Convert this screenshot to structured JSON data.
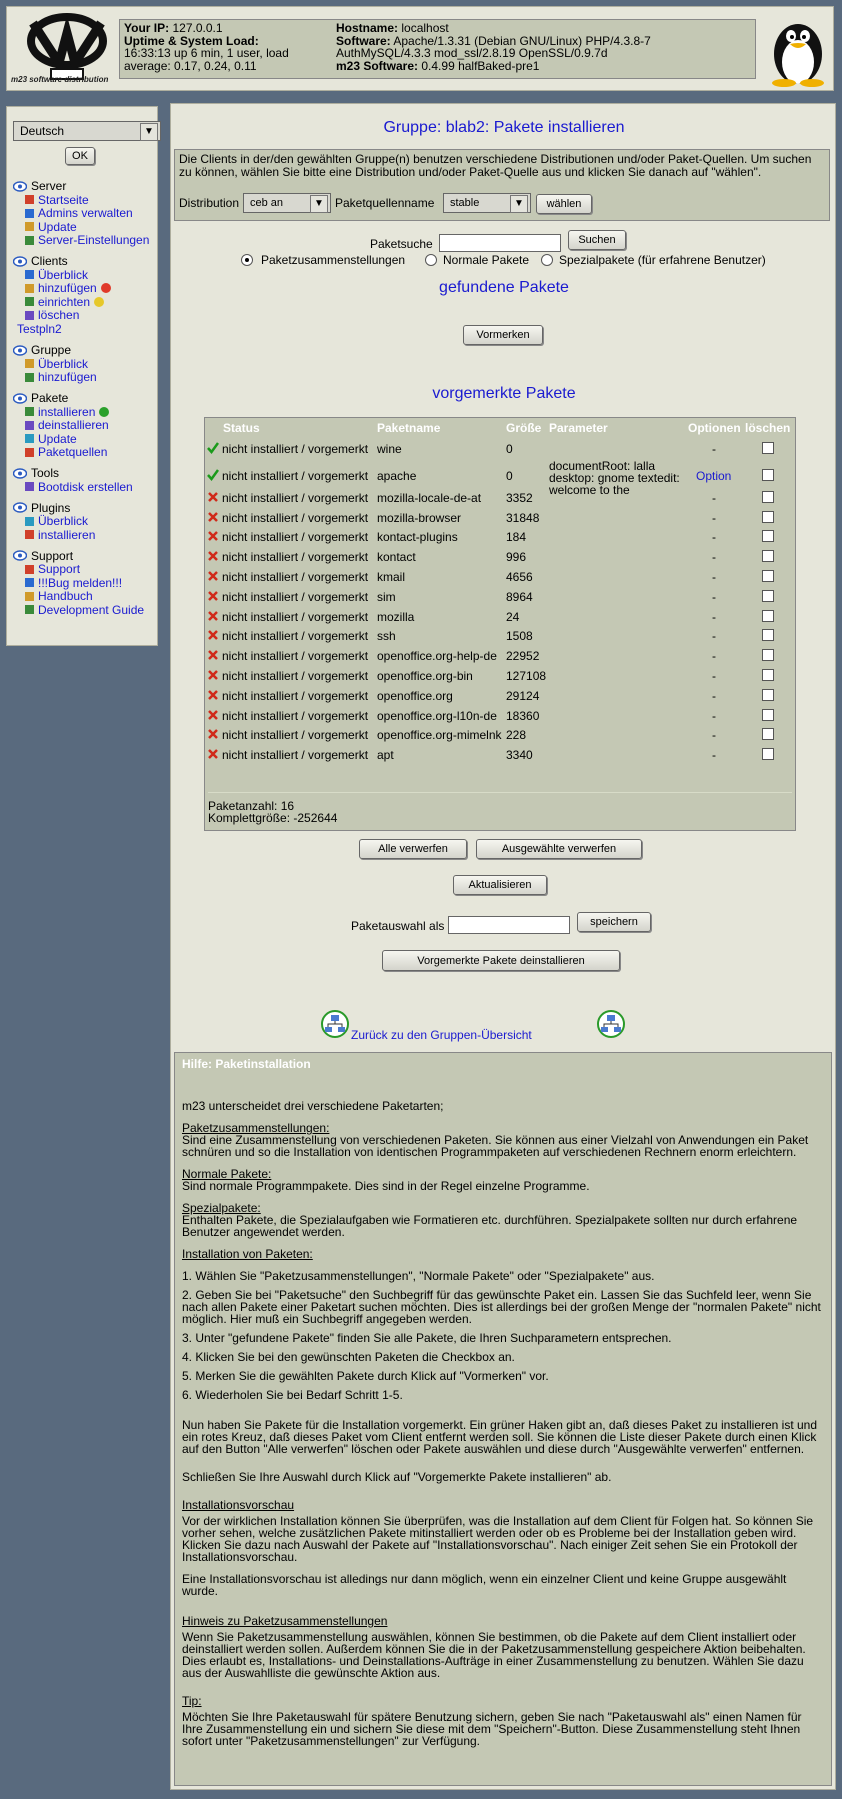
{
  "header": {
    "logo_text": "m23 software distribution",
    "your_ip_label": "Your IP:",
    "your_ip": "127.0.0.1",
    "uptime_label": "Uptime & System Load:",
    "uptime_value": "16:33:13 up 6 min, 1 user, load average: 0.17, 0.24, 0.11",
    "hostname_label": "Hostname:",
    "hostname": "localhost",
    "software_label": "Software:",
    "software_value": "Apache/1.3.31 (Debian GNU/Linux) PHP/4.3.8-7 AuthMySQL/4.3.3 mod_ssl/2.8.19 OpenSSL/0.9.7d",
    "m23_label": "m23 Software:",
    "m23_version": "0.4.99 halfBaked-pre1"
  },
  "sidebar": {
    "language": "Deutsch",
    "ok_label": "OK",
    "sections": [
      {
        "title": "Server",
        "items": [
          "Startseite",
          "Admins verwalten",
          "Update",
          "Server-Einstellungen"
        ]
      },
      {
        "title": "Clients",
        "items": [
          "Überblick",
          "hinzufügen",
          "einrichten",
          "löschen"
        ],
        "extra": "Testpln2"
      },
      {
        "title": "Gruppe",
        "items": [
          "Überblick",
          "hinzufügen"
        ]
      },
      {
        "title": "Pakete",
        "items": [
          "installieren",
          "deinstallieren",
          "Update",
          "Paketquellen"
        ]
      },
      {
        "title": "Tools",
        "items": [
          "Bootdisk erstellen"
        ]
      },
      {
        "title": "Plugins",
        "items": [
          "Überblick",
          "installieren"
        ]
      },
      {
        "title": "Support",
        "items": [
          "Support",
          "!!!Bug melden!!!",
          "Handbuch",
          "Development Guide"
        ]
      }
    ]
  },
  "main": {
    "title": "Gruppe: blab2: Pakete installieren",
    "notice": "Die Clients in der/den gewählten Gruppe(n) benutzen verschiedene Distributionen und/oder Paket-Quellen. Um suchen zu können, wählen Sie bitte eine Distribution und/oder Paket-Quelle aus und klicken Sie danach auf \"wählen\".",
    "distribution_label": "Distribution",
    "distribution_value": "ceb an",
    "source_label": "Paketquellenname",
    "source_value": "stable",
    "choose_label": "wählen",
    "search_label": "Paketsuche",
    "search_button": "Suchen",
    "radio_options": [
      "Paketzusammenstellungen",
      "Normale Pakete",
      "Spezialpakete (für erfahrene Benutzer)"
    ],
    "found_title": "gefundene Pakete",
    "mark_button": "Vormerken",
    "marked_title": "vorgemerkte Pakete",
    "table_headers": [
      "Status",
      "Paketname",
      "Größe",
      "Parameter",
      "Optionen",
      "löschen"
    ],
    "packages": [
      {
        "ok": true,
        "status": "nicht installiert / vorgemerkt",
        "name": "wine",
        "size": "0",
        "param": "",
        "option": "-"
      },
      {
        "ok": true,
        "status": "nicht installiert / vorgemerkt",
        "name": "apache",
        "size": "0",
        "param": "documentRoot: lalla desktop: gnome textedit: welcome to the",
        "option": "Option"
      },
      {
        "ok": false,
        "status": "nicht installiert / vorgemerkt",
        "name": "mozilla-locale-de-at",
        "size": "3352",
        "param": "",
        "option": "-"
      },
      {
        "ok": false,
        "status": "nicht installiert / vorgemerkt",
        "name": "mozilla-browser",
        "size": "31848",
        "param": "",
        "option": "-"
      },
      {
        "ok": false,
        "status": "nicht installiert / vorgemerkt",
        "name": "kontact-plugins",
        "size": "184",
        "param": "",
        "option": "-"
      },
      {
        "ok": false,
        "status": "nicht installiert / vorgemerkt",
        "name": "kontact",
        "size": "996",
        "param": "",
        "option": "-"
      },
      {
        "ok": false,
        "status": "nicht installiert / vorgemerkt",
        "name": "kmail",
        "size": "4656",
        "param": "",
        "option": "-"
      },
      {
        "ok": false,
        "status": "nicht installiert / vorgemerkt",
        "name": "sim",
        "size": "8964",
        "param": "",
        "option": "-"
      },
      {
        "ok": false,
        "status": "nicht installiert / vorgemerkt",
        "name": "mozilla",
        "size": "24",
        "param": "",
        "option": "-"
      },
      {
        "ok": false,
        "status": "nicht installiert / vorgemerkt",
        "name": "ssh",
        "size": "1508",
        "param": "",
        "option": "-"
      },
      {
        "ok": false,
        "status": "nicht installiert / vorgemerkt",
        "name": "openoffice.org-help-de",
        "size": "22952",
        "param": "",
        "option": "-"
      },
      {
        "ok": false,
        "status": "nicht installiert / vorgemerkt",
        "name": "openoffice.org-bin",
        "size": "127108",
        "param": "",
        "option": "-"
      },
      {
        "ok": false,
        "status": "nicht installiert / vorgemerkt",
        "name": "openoffice.org",
        "size": "29124",
        "param": "",
        "option": "-"
      },
      {
        "ok": false,
        "status": "nicht installiert / vorgemerkt",
        "name": "openoffice.org-l10n-de",
        "size": "18360",
        "param": "",
        "option": "-"
      },
      {
        "ok": false,
        "status": "nicht installiert / vorgemerkt",
        "name": "openoffice.org-mimelnk",
        "size": "228",
        "param": "",
        "option": "-"
      },
      {
        "ok": false,
        "status": "nicht installiert / vorgemerkt",
        "name": "apt",
        "size": "3340",
        "param": "",
        "option": "-"
      }
    ],
    "package_count": "Paketanzahl: 16",
    "total_size": "Komplettgröße: -252644",
    "discard_all": "Alle verwerfen",
    "discard_selected": "Ausgewählte verwerfen",
    "refresh": "Aktualisieren",
    "save_as_label": "Paketauswahl als",
    "save_button": "speichern",
    "uninstall_marked": "Vorgemerkte Pakete deinstallieren",
    "back_link": "Zurück zu den Gruppen-Übersicht"
  },
  "help": {
    "title": "Hilfe: Paketinstallation",
    "intro": "m23 unterscheidet drei verschiedene Paketarten;",
    "t1": "Paketzusammenstellungen:",
    "p1": "Sind eine Zusammenstellung von verschiedenen Paketen. Sie können aus einer Vielzahl von Anwendungen ein Paket schnüren und so die Installation von identischen Programmpaketen auf verschiedenen Rechnern enorm erleichtern.",
    "t2": "Normale Pakete:",
    "p2": "Sind normale Programmpakete. Dies sind in der Regel einzelne Programme.",
    "t3": "Spezialpakete:",
    "p3": "Enthalten Pakete, die Spezialaufgaben wie Formatieren etc. durchführen. Spezialpakete sollten nur durch erfahrene Benutzer angewendet werden.",
    "t4": "Installation von Paketen:",
    "steps": [
      "1. Wählen Sie \"Paketzusammenstellungen\", \"Normale Pakete\" oder \"Spezialpakete\" aus.",
      "2. Geben Sie bei \"Paketsuche\" den Suchbegriff für das gewünschte Paket ein. Lassen Sie das Suchfeld leer, wenn Sie nach allen Pakete einer Paketart suchen möchten. Dies ist allerdings bei der großen Menge der \"normalen Pakete\" nicht möglich. Hier muß ein Suchbegriff angegeben werden.",
      "3. Unter \"gefundene Pakete\" finden Sie alle Pakete, die Ihren Suchparametern entsprechen.",
      "4. Klicken Sie bei den gewünschten Paketen die Checkbox an.",
      "5. Merken Sie die gewählten Pakete durch Klick auf \"Vormerken\" vor.",
      "6. Wiederholen Sie bei Bedarf Schritt 1-5."
    ],
    "p4": "Nun haben Sie Pakete für die Installation vorgemerkt. Ein grüner Haken gibt an, daß dieses Paket zu installieren ist und ein rotes Kreuz, daß dieses Paket vom Client entfernt werden soll. Sie können die Liste dieser Pakete durch einen Klick auf den Button \"Alle verwerfen\" löschen oder Pakete auswählen und diese durch \"Ausgewählte verwerfen\" entfernen.",
    "p5": "Schließen Sie Ihre Auswahl durch Klick auf \"Vorgemerkte Pakete installieren\" ab.",
    "t5": "Installationsvorschau",
    "p6": "Vor der wirklichen Installation können Sie überprüfen, was die Installation auf dem Client für Folgen hat. So können Sie vorher sehen, welche zusätzlichen Pakete mitinstalliert werden oder ob es Probleme bei der Installation geben wird. Klicken Sie dazu nach Auswahl der Pakete auf \"Installationsvorschau\". Nach einiger Zeit sehen Sie ein Protokoll der Installationsvorschau.",
    "p7": "Eine Installationsvorschau ist alledings nur dann möglich, wenn ein einzelner Client und keine Gruppe ausgewählt wurde.",
    "t6": "Hinweis zu Paketzusammenstellungen",
    "p8": "Wenn Sie Paketzusammenstellung auswählen, können Sie bestimmen, ob die Pakete auf dem Client installiert oder deinstalliert werden sollen. Außerdem können Sie die in der Paketzusammenstellung gespeichere Aktion beibehalten. Dies erlaubt es, Installations- und Deinstallations-Aufträge in einer Zusammenstellung zu benutzen. Wählen Sie dazu aus der Auswahlliste die gewünschte Aktion aus.",
    "t7": "Tip:",
    "p9": "Möchten Sie Ihre Paketauswahl für spätere Benutzung sichern, geben Sie nach \"Paketauswahl als\" einen Namen für Ihre Zusammenstellung ein und sichern Sie diese mit dem \"Speichern\"-Button. Diese Zusammenstellung steht Ihnen sofort unter \"Paketzusammenstellungen\" zur Verfügung."
  }
}
